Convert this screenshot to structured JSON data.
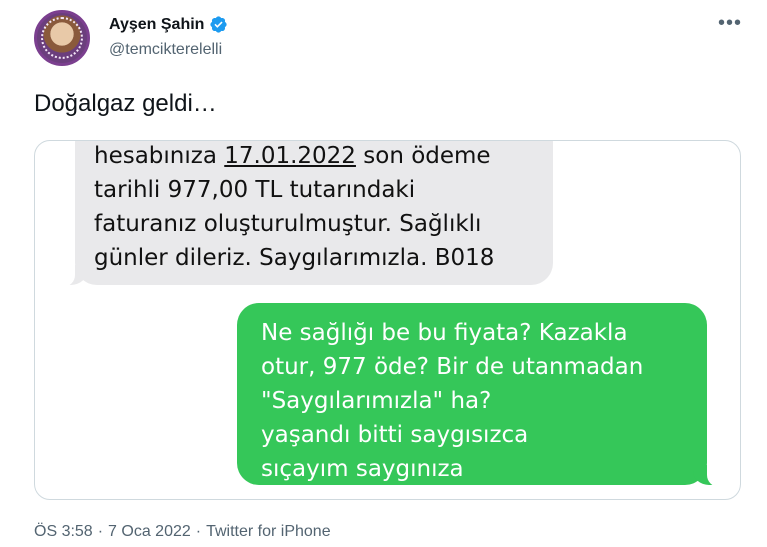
{
  "author": {
    "display_name": "Ayşen Şahin",
    "handle": "@temcikterelelli",
    "verified_icon": "verified-badge-icon",
    "verified_color": "#1d9bf0"
  },
  "more_label": "•••",
  "tweet": {
    "text": "Doğalgaz geldi…"
  },
  "media": {
    "incoming": {
      "line1_pre": "hesabınıza ",
      "line1_date": "17.01.2022",
      "line1_post": " son ödeme",
      "lines": [
        "tarihli 977,00 TL tutarındaki",
        "faturanız oluşturulmuştur. Sağlıklı",
        "günler dileriz. Saygılarımızla. B018"
      ]
    },
    "outgoing": {
      "lines": [
        "Ne sağlığı be bu fiyata? Kazakla",
        "otur, 977 öde? Bir de utanmadan",
        "\"Saygılarımızla\" ha?",
        "yaşandı bitti saygısızca",
        "sıçayım saygınıza"
      ]
    },
    "colors": {
      "incoming_bg": "#e9e9eb",
      "outgoing_bg": "#35c759"
    }
  },
  "meta": {
    "time": "ÖS 3:58",
    "sep1": "·",
    "date": "7 Oca 2022",
    "sep2": "·",
    "source": "Twitter for iPhone"
  }
}
